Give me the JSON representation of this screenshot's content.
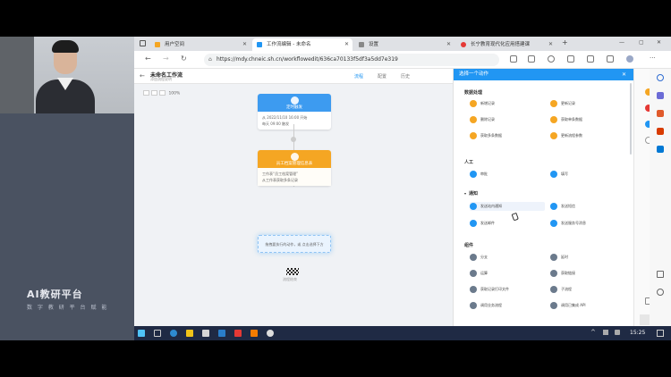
{
  "browser": {
    "tabs": [
      {
        "label": "用户空间",
        "color": "#f5a623"
      },
      {
        "label": "工作流编辑 - 未命名",
        "color": "#2196f3"
      },
      {
        "label": "设置",
        "color": "#888888"
      },
      {
        "label": "长宁教育现代化应用搭建课",
        "color": "#e53935"
      }
    ],
    "url": "https://mdy.chneic.sh.cn/workflowedit/636ca70133f5df3a5dd7e319"
  },
  "workflow": {
    "title": "未命名工作流",
    "subtitle": "添加流程说明",
    "tabs": [
      "流程",
      "配置",
      "历史"
    ],
    "zoom": "100%",
    "trigger_node": {
      "title": "定时触发",
      "line1": "从 2022/11/10 16:00 开始",
      "line2": "每天 09:00 触发"
    },
    "action_node": {
      "title": "员工档案管理信息表",
      "line1": "工作表“员工档案管理”",
      "line2": "从工作表获取多条记录"
    },
    "drop_hint": "拖拽要执行的动作，或 点击选择下方",
    "end_label": "流程结束"
  },
  "action_panel": {
    "header": "选择一个动作",
    "sections": [
      {
        "title": "数据处理",
        "items": [
          "新增记录",
          "更新记录",
          "删除记录",
          "获取单条数据",
          "获取多条数据",
          "更新流程参数"
        ]
      },
      {
        "title": "人工",
        "items": [
          "审批",
          "填写"
        ]
      },
      {
        "title": "通知",
        "items": [
          "发送站内通知",
          "发送短信",
          "发送邮件",
          "发送服务号消息"
        ]
      },
      {
        "title": "组件",
        "items": [
          "分支",
          "延时",
          "运算",
          "获取链接",
          "获取记录打印文件",
          "子流程",
          "调用业务流程",
          "调用已集成 API"
        ]
      }
    ]
  },
  "taskbar": {
    "time": "15:25"
  },
  "logo": {
    "line1": "AI教研平台",
    "line2": "数 字 教 研 平 台 赋 能"
  }
}
